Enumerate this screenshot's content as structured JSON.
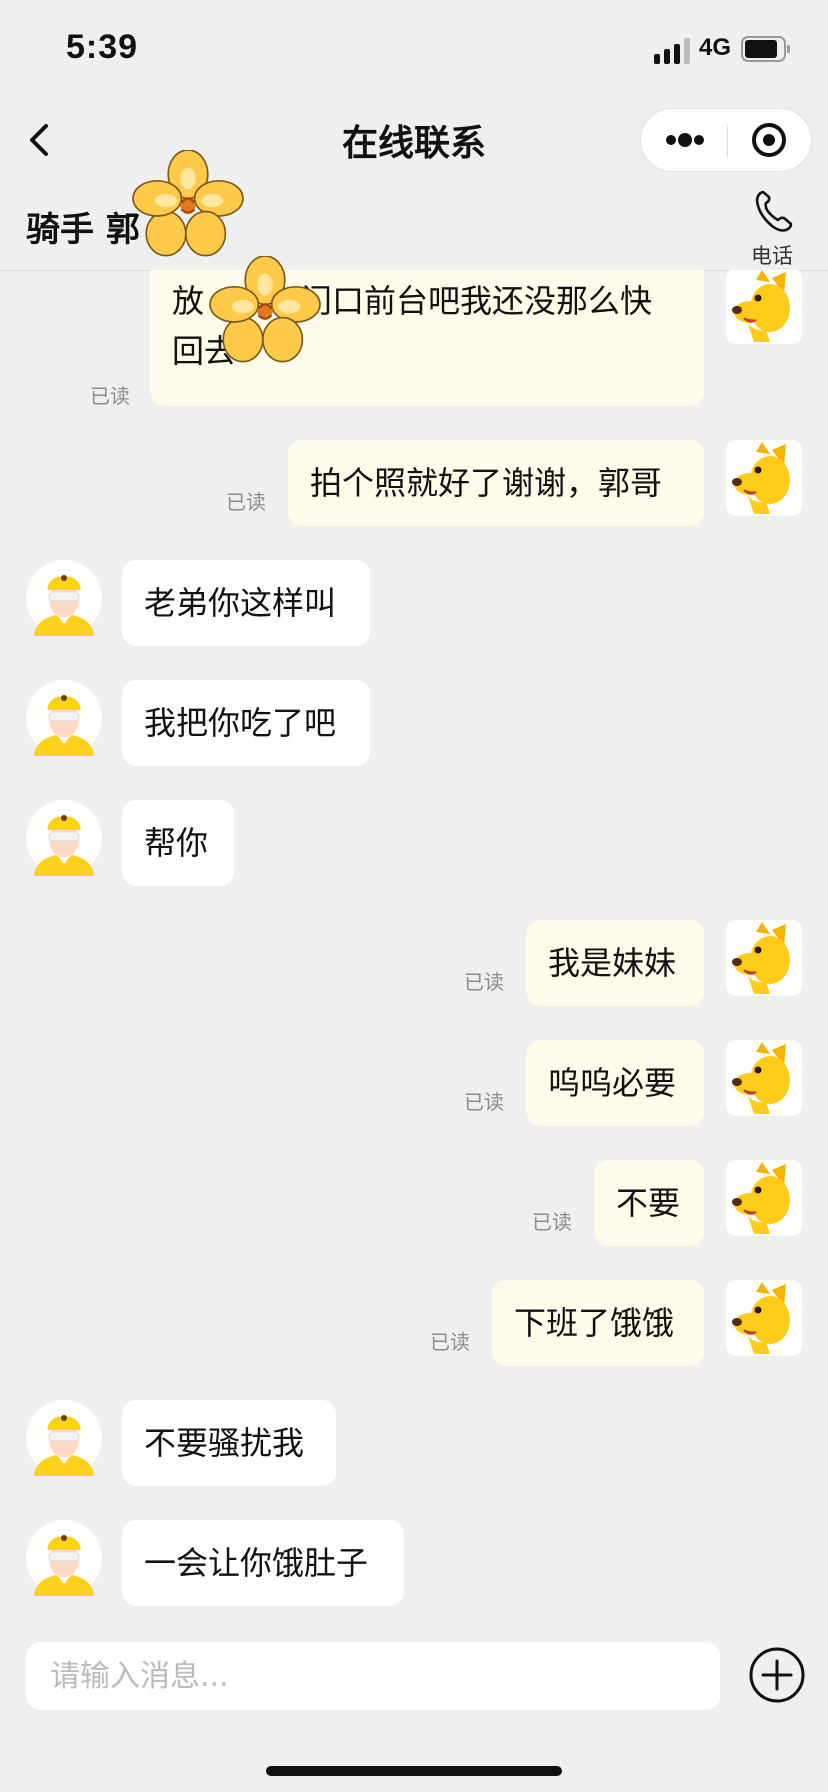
{
  "status_bar": {
    "time": "5:39",
    "network": "4G"
  },
  "nav": {
    "title": "在线联系"
  },
  "rider": {
    "name": "骑手 郭",
    "phone_label": "电话"
  },
  "messages": [
    {
      "side": "out",
      "text_line1": "放",
      "text_line1b": "门口前台吧我还没那么快",
      "text_line2": "回去",
      "read": "已读"
    },
    {
      "side": "out",
      "text": "拍个照就好了谢谢，郭哥",
      "read": "已读"
    },
    {
      "side": "in",
      "text": "老弟你这样叫"
    },
    {
      "side": "in",
      "text": "我把你吃了吧"
    },
    {
      "side": "in",
      "text": "帮你"
    },
    {
      "side": "out",
      "text": "我是妹妹",
      "read": "已读"
    },
    {
      "side": "out",
      "text": "呜呜必要",
      "read": "已读"
    },
    {
      "side": "out",
      "text": "不要",
      "read": "已读"
    },
    {
      "side": "out",
      "text": "下班了饿饿",
      "read": "已读"
    },
    {
      "side": "in",
      "text": "不要骚扰我"
    },
    {
      "side": "in",
      "text": "一会让你饿肚子"
    }
  ],
  "input": {
    "placeholder": "请输入消息..."
  },
  "colors": {
    "outgoing_bubble": "#fffbea",
    "incoming_bubble": "#ffffff",
    "background": "#efefef",
    "brand_yellow": "#ffd21e"
  },
  "icons": [
    "back-icon",
    "more-icon",
    "target-icon",
    "phone-icon",
    "add-icon",
    "dog-avatar",
    "rider-avatar",
    "flower-sticker"
  ]
}
